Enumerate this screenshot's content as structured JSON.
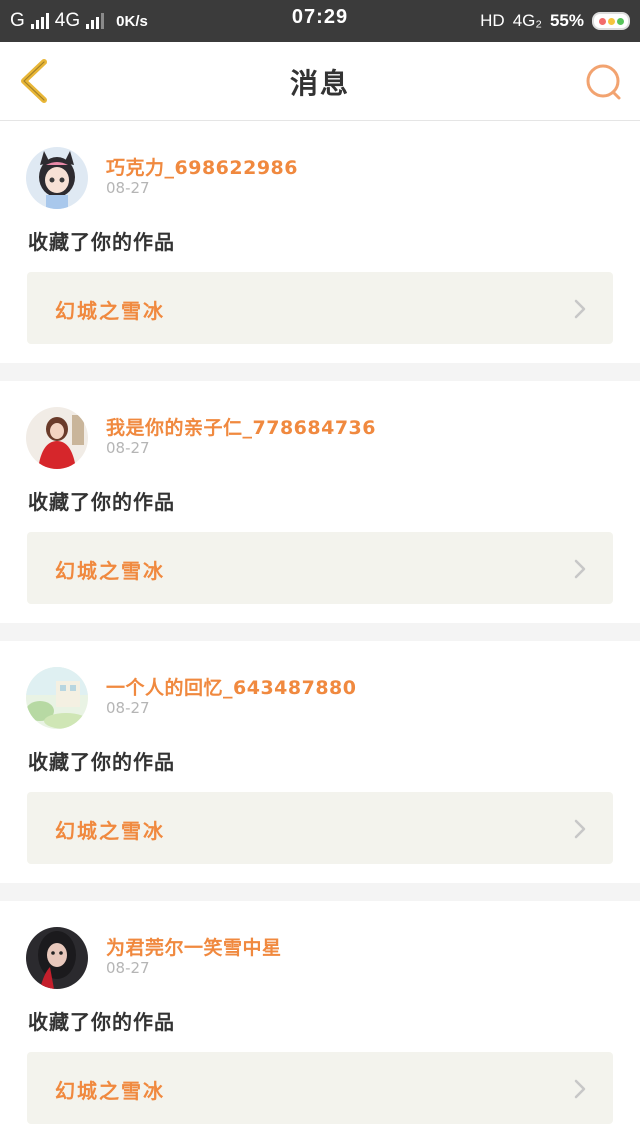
{
  "status_bar": {
    "carrier1": "G",
    "carrier2": "4G",
    "speed": "0K/s",
    "time": "07:29",
    "network": "HD",
    "network2": "4G₂",
    "battery": "55%"
  },
  "header": {
    "title": "消息",
    "back_icon": "chevron-left-icon",
    "search_icon": "search-icon"
  },
  "colors": {
    "accent": "#f0893f",
    "back_icon": "#e8b637",
    "search_icon": "#f2a370"
  },
  "messages": [
    {
      "username": "巧克力_698622986",
      "date": "08-27",
      "action": "收藏了你的作品",
      "work_title": "幻城之雪冰"
    },
    {
      "username": "我是你的亲子仁_778684736",
      "date": "08-27",
      "action": "收藏了你的作品",
      "work_title": "幻城之雪冰"
    },
    {
      "username": "一个人的回忆_643487880",
      "date": "08-27",
      "action": "收藏了你的作品",
      "work_title": "幻城之雪冰"
    },
    {
      "username": "为君莞尔一笑雪中星",
      "date": "08-27",
      "action": "收藏了你的作品",
      "work_title": "幻城之雪冰"
    }
  ]
}
